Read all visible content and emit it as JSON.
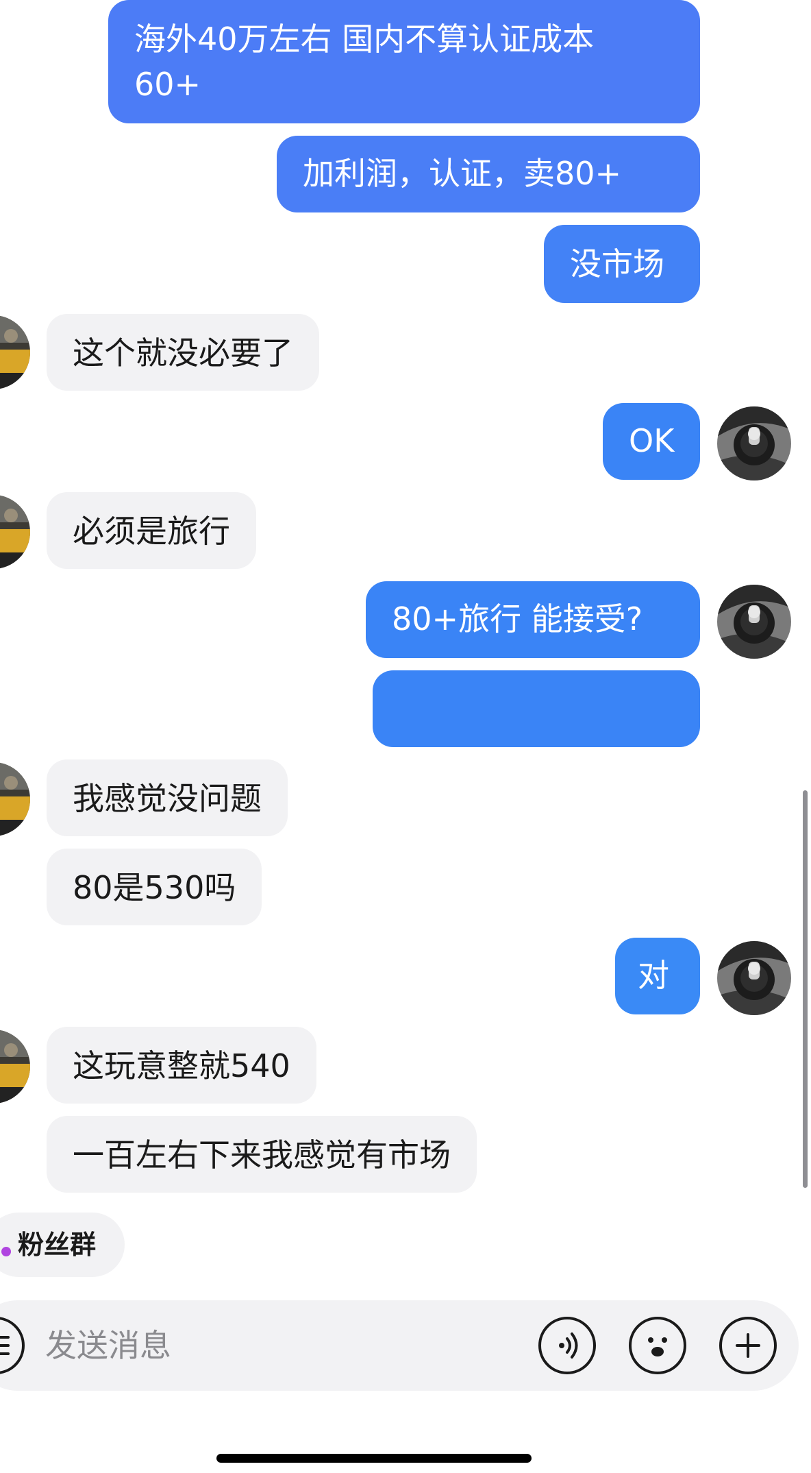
{
  "chat": {
    "outgoing": [
      {
        "line1": "海外40万左右  国内不算认证成本",
        "line2": "60+"
      },
      {
        "text": "加利润，认证，卖80+"
      },
      {
        "text": "没市场"
      },
      {
        "text": "OK"
      },
      {
        "text": "80+旅行 能接受?"
      },
      {
        "text": "对"
      }
    ],
    "incoming": [
      {
        "text": "这个就没必要了"
      },
      {
        "text": "必须是旅行"
      },
      {
        "text": "我感觉没问题"
      },
      {
        "text": "80是530吗"
      },
      {
        "text": "这玩意整就540"
      },
      {
        "text": "一百左右下来我感觉有市场"
      }
    ]
  },
  "fan_group": {
    "label": "粉丝群"
  },
  "input": {
    "placeholder": "发送消息"
  },
  "icons": {
    "menu": "menu-lines-icon",
    "voice": "voice-wave-icon",
    "emoji": "smiley-icon",
    "plus": "plus-icon"
  },
  "colors": {
    "outgoing_bubble_light": "#4c7cf6",
    "outgoing_bubble": "#3a84f6",
    "incoming_bubble": "#f2f2f4",
    "fan_dot": "#b044e0"
  }
}
